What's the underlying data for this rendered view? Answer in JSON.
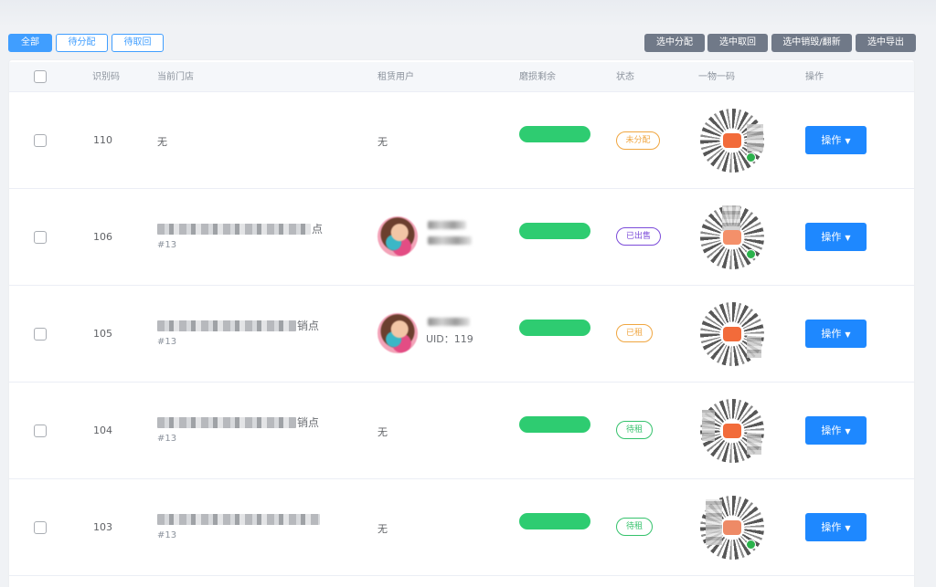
{
  "filters": [
    "全部",
    "待分配",
    "待取回"
  ],
  "actions": [
    "选中分配",
    "选中取回",
    "选中销毁/翻新",
    "选中导出"
  ],
  "columns": [
    "识别码",
    "当前门店",
    "租赁用户",
    "磨损剩余",
    "状态",
    "一物一码",
    "操作"
  ],
  "rows": [
    {
      "id": "110",
      "store": "无",
      "store_sub": "",
      "store_end": "",
      "user": "无",
      "uid": "",
      "status": "未分配",
      "op": "操作"
    },
    {
      "id": "106",
      "store": "",
      "store_sub": "#13",
      "store_end": "点",
      "user": "",
      "uid": "",
      "status": "已出售",
      "op": "操作"
    },
    {
      "id": "105",
      "store": "",
      "store_sub": "#13",
      "store_end": "销点",
      "user": "",
      "uid": "UID：119",
      "status": "已租",
      "op": "操作"
    },
    {
      "id": "104",
      "store": "",
      "store_sub": "#13",
      "store_end": "销点",
      "user": "无",
      "uid": "",
      "status": "待租",
      "op": "操作"
    },
    {
      "id": "103",
      "store": "",
      "store_sub": "#13",
      "store_end": "",
      "user": "无",
      "uid": "",
      "status": "待租",
      "op": "操作"
    }
  ],
  "colors": {
    "primary": "#409eff",
    "op_button": "#1e88ff",
    "action_button": "#707988",
    "progress": "#2ecc71",
    "status_unassigned": "#f0a640",
    "status_sold": "#7b4bd9",
    "status_rented": "#f0a640",
    "status_available": "#35c26c"
  },
  "icons": {
    "chevron": "chevron-down-icon",
    "qr": "qr-code-icon",
    "mini_program": "wechat-mini-program-icon"
  }
}
